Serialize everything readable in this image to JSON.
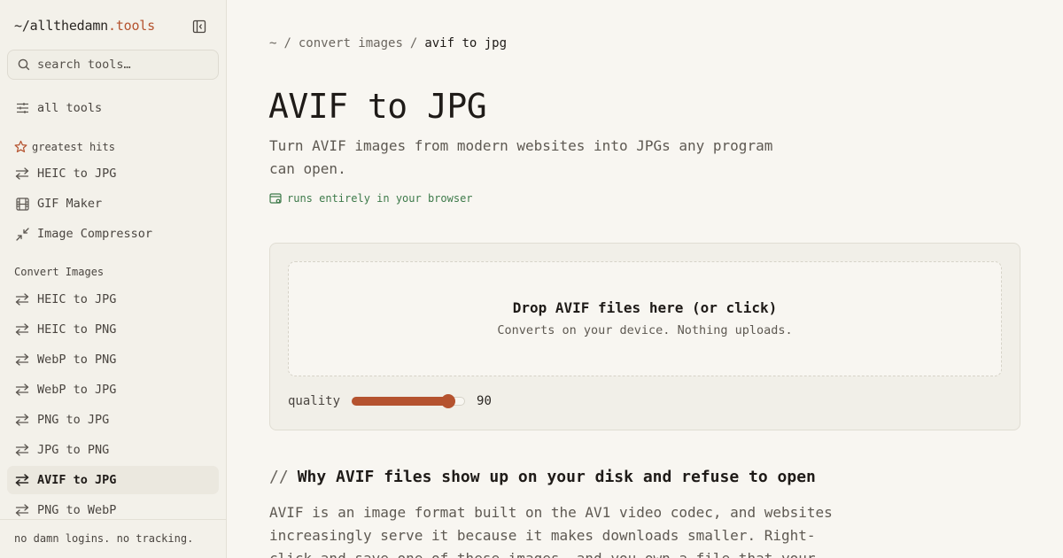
{
  "brand": {
    "prefix": "~/",
    "name": "allthedamn",
    "suffix": ".tools"
  },
  "search": {
    "placeholder": "search tools…"
  },
  "sidebar": {
    "all_tools": "all tools",
    "greatest_hits_label": "greatest hits",
    "greatest_hits": [
      {
        "label": "HEIC to JPG",
        "icon": "arrows-swap-icon"
      },
      {
        "label": "GIF Maker",
        "icon": "film-icon"
      },
      {
        "label": "Image Compressor",
        "icon": "compress-icon"
      }
    ],
    "convert_label": "Convert Images",
    "convert_items": [
      {
        "label": "HEIC to JPG"
      },
      {
        "label": "HEIC to PNG"
      },
      {
        "label": "WebP to PNG"
      },
      {
        "label": "WebP to JPG"
      },
      {
        "label": "PNG to JPG"
      },
      {
        "label": "JPG to PNG"
      },
      {
        "label": "AVIF to JPG",
        "active": true
      },
      {
        "label": "PNG to WebP"
      }
    ],
    "footer": "no damn logins. no tracking."
  },
  "breadcrumb": {
    "root": "~",
    "section": "convert images",
    "current": "avif to jpg"
  },
  "page": {
    "title": "AVIF to JPG",
    "subtitle": "Turn AVIF images from modern websites into JPGs any program can open.",
    "badge": "runs entirely in your browser"
  },
  "dropzone": {
    "title": "Drop AVIF files here (or click)",
    "subtitle": "Converts on your device. Nothing uploads."
  },
  "quality": {
    "label": "quality",
    "value": "90",
    "min": 1,
    "max": 100
  },
  "section": {
    "slashes": "//",
    "heading": "Why AVIF files show up on your disk and refuse to open",
    "body": "AVIF is an image format built on the AV1 video codec, and websites increasingly serve it because it makes downloads smaller. Right-click and save one of these images, and you own a file that your"
  },
  "colors": {
    "accent": "#b5532f",
    "badge_green": "#3d7a4a",
    "background": "#f8f6f1",
    "sidebar_bg": "#f3f1ea"
  }
}
